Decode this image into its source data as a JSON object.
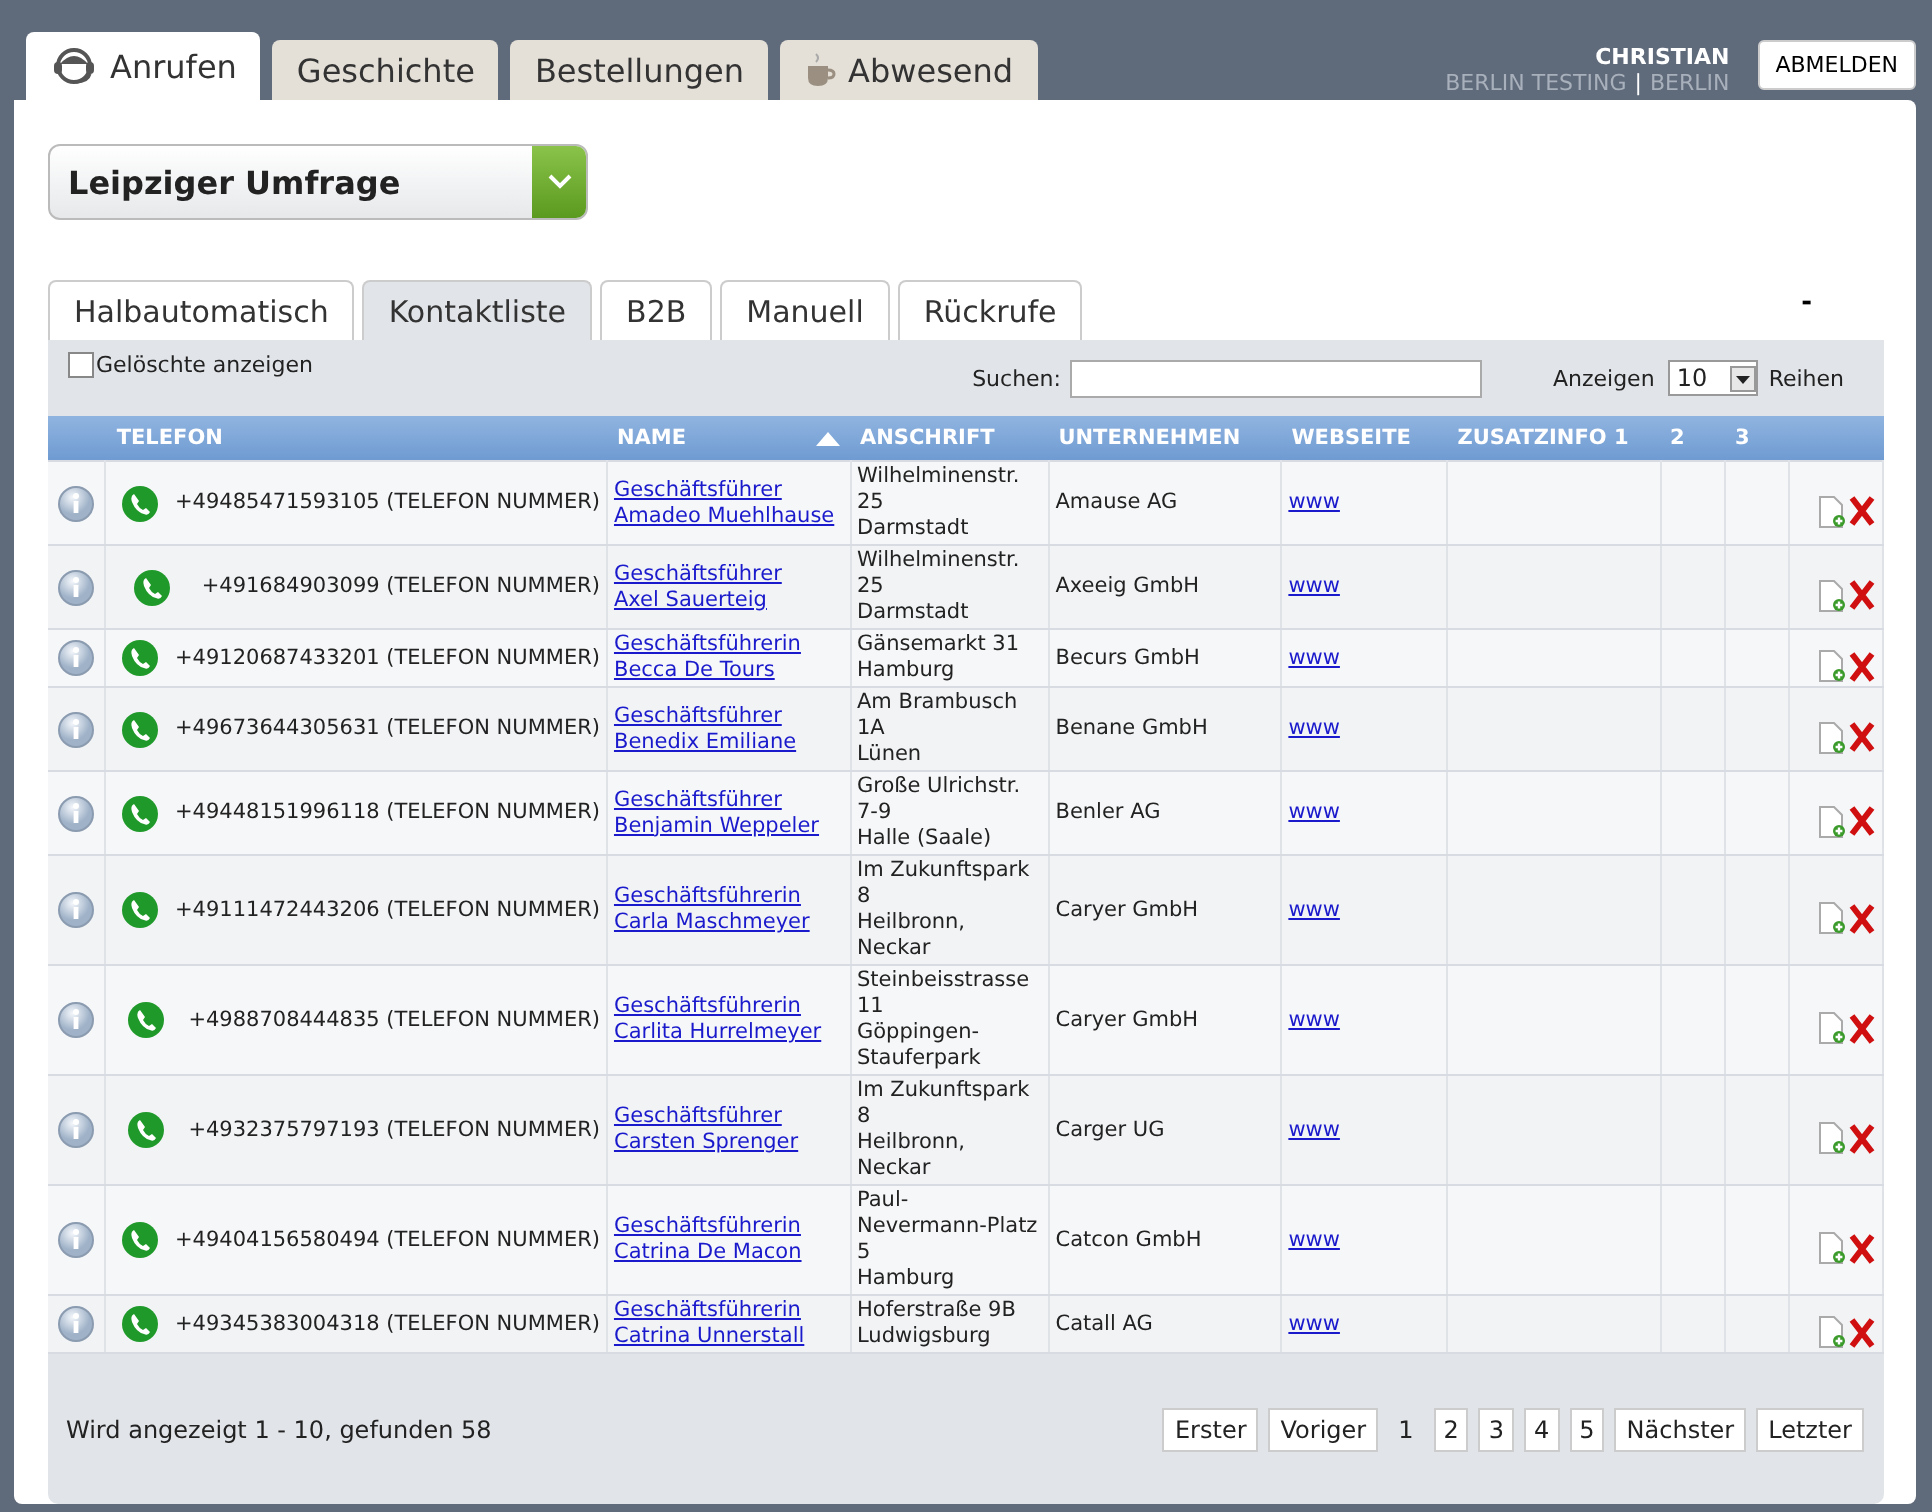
{
  "main_tabs": [
    {
      "label": "Anrufen",
      "selected": true
    },
    {
      "label": "Geschichte",
      "selected": false
    },
    {
      "label": "Bestellungen",
      "selected": false
    },
    {
      "label": "Abwesend",
      "selected": false
    }
  ],
  "user": {
    "name": "CHRISTIAN",
    "location": "BERLIN TESTING",
    "separator": "|",
    "city": "BERLIN",
    "logout": "ABMELDEN"
  },
  "campaign_select": {
    "value": "Leipziger Umfrage"
  },
  "sub_tabs": [
    {
      "label": "Halbautomatisch",
      "selected": false
    },
    {
      "label": "Kontaktliste",
      "selected": true
    },
    {
      "label": "B2B",
      "selected": false
    },
    {
      "label": "Manuell",
      "selected": false
    },
    {
      "label": "Rückrufe",
      "selected": false
    }
  ],
  "corner_mark": "-",
  "show_deleted": {
    "label": "Gelöschte anzeigen",
    "checked": false
  },
  "search": {
    "label": "Suchen:"
  },
  "page_size": {
    "label": "Anzeigen",
    "value": "10",
    "suffix": "Reihen"
  },
  "table": {
    "columns": [
      {
        "label": "TELEFON"
      },
      {
        "label": "NAME",
        "sorted": true
      },
      {
        "label": "ANSCHRIFT"
      },
      {
        "label": "UNTERNEHMEN"
      },
      {
        "label": "WEBSEITE"
      },
      {
        "label": "ZUSATZINFO 1"
      },
      {
        "label": "2"
      },
      {
        "label": "3"
      }
    ],
    "rows": [
      {
        "phone": "+49485471593105 (TELEFON NUMMER)",
        "title": "Geschäftsführer",
        "name": "Amadeo Muehlhause",
        "address": [
          "Wilhelminenstr.",
          "25",
          "Darmstadt"
        ],
        "company": "Amause AG",
        "website": "www"
      },
      {
        "phone": "+491684903099 (TELEFON NUMMER)",
        "title": "Geschäftsführer",
        "name": "Axel Sauerteig",
        "address": [
          "Wilhelminenstr.",
          "25",
          "Darmstadt"
        ],
        "company": "Axeeig GmbH",
        "website": "www"
      },
      {
        "phone": "+49120687433201 (TELEFON NUMMER)",
        "title": "Geschäftsführerin",
        "name": "Becca De Tours",
        "address": [
          "Gänsemarkt 31",
          "Hamburg"
        ],
        "company": "Becurs GmbH",
        "website": "www"
      },
      {
        "phone": "+49673644305631 (TELEFON NUMMER)",
        "title": "Geschäftsführer",
        "name": "Benedix Emiliane",
        "address": [
          "Am Brambusch",
          "1A",
          "Lünen"
        ],
        "company": "Benane GmbH",
        "website": "www"
      },
      {
        "phone": "+49448151996118 (TELEFON NUMMER)",
        "title": "Geschäftsführer",
        "name": "Benjamin Weppeler",
        "address": [
          "Große Ulrichstr.",
          "7-9",
          "Halle (Saale)"
        ],
        "company": "Benler AG",
        "website": "www"
      },
      {
        "phone": "+49111472443206 (TELEFON NUMMER)",
        "title": "Geschäftsführerin",
        "name": "Carla Maschmeyer",
        "address": [
          "Im Zukunftspark",
          "8",
          "Heilbronn,",
          "Neckar"
        ],
        "company": "Caryer GmbH",
        "website": "www"
      },
      {
        "phone": "+4988708444835 (TELEFON NUMMER)",
        "title": "Geschäftsführerin",
        "name": "Carlita Hurrelmeyer",
        "address": [
          "Steinbeisstrasse",
          "11",
          "Göppingen-",
          "Stauferpark"
        ],
        "company": "Caryer GmbH",
        "website": "www"
      },
      {
        "phone": "+4932375797193 (TELEFON NUMMER)",
        "title": "Geschäftsführer",
        "name": "Carsten Sprenger",
        "address": [
          "Im Zukunftspark",
          "8",
          "Heilbronn,",
          "Neckar"
        ],
        "company": "Carger UG",
        "website": "www"
      },
      {
        "phone": "+49404156580494 (TELEFON NUMMER)",
        "title": "Geschäftsführerin",
        "name": "Catrina De Macon",
        "address": [
          "Paul-",
          "Nevermann-Platz",
          "5",
          "Hamburg"
        ],
        "company": "Catcon GmbH",
        "website": "www"
      },
      {
        "phone": "+49345383004318 (TELEFON NUMMER)",
        "title": "Geschäftsführerin",
        "name": "Catrina Unnerstall",
        "address": [
          "Hoferstraße 9B",
          "Ludwigsburg"
        ],
        "company": "Catall AG",
        "website": "www"
      }
    ]
  },
  "summary": "Wird angezeigt 1 - 10, gefunden 58",
  "pagination": [
    {
      "label": "Erster",
      "kind": "nav"
    },
    {
      "label": "Voriger",
      "kind": "nav"
    },
    {
      "label": "1",
      "kind": "page",
      "selected": true
    },
    {
      "label": "2",
      "kind": "page",
      "selected": false
    },
    {
      "label": "3",
      "kind": "page",
      "selected": false
    },
    {
      "label": "4",
      "kind": "page",
      "selected": false
    },
    {
      "label": "5",
      "kind": "page",
      "selected": false
    },
    {
      "label": "Nächster",
      "kind": "nav"
    },
    {
      "label": "Letzter",
      "kind": "nav"
    }
  ]
}
